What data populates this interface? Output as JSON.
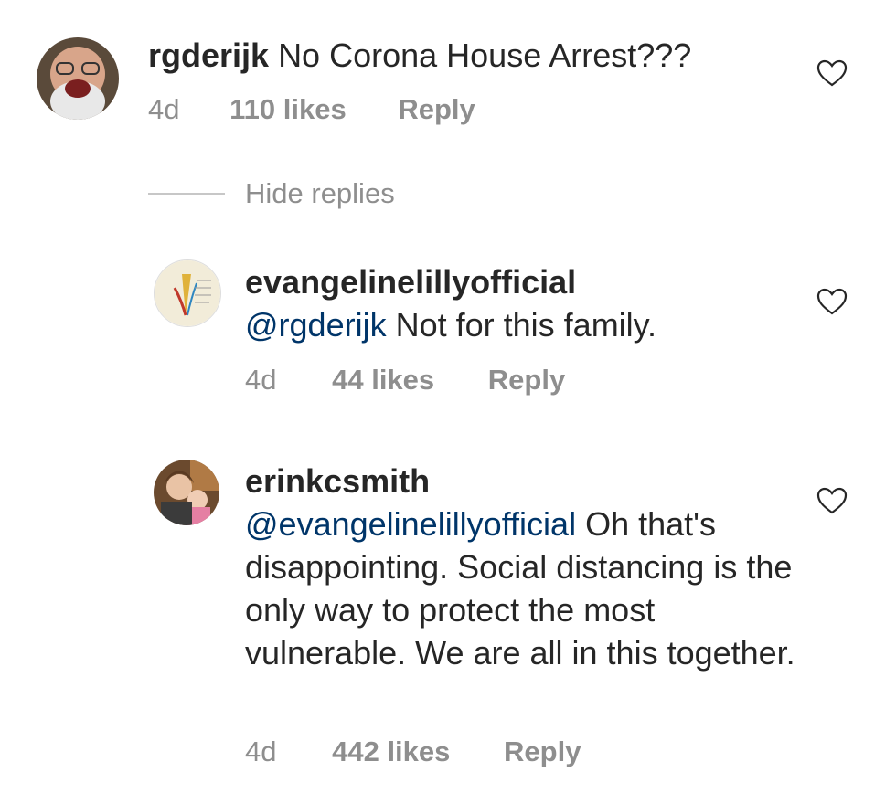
{
  "comments": [
    {
      "username": "rgderijk",
      "mention": "",
      "text": "No Corona House Arrest???",
      "time": "4d",
      "likes": "110 likes",
      "reply": "Reply"
    },
    {
      "username": "evangelinelillyofficial",
      "mention": "@rgderijk",
      "text": "Not for this family.",
      "time": "4d",
      "likes": "44 likes",
      "reply": "Reply"
    },
    {
      "username": "erinkcsmith",
      "mention": "@evangelinelillyofficial",
      "text": "Oh that's disappointing. Social distancing is the only way to protect the most vulnerable. We are all in this together.",
      "time": "4d",
      "likes": "442 likes",
      "reply": "Reply"
    }
  ],
  "hide_replies": "Hide replies",
  "icons": {
    "like": "heart-outline-icon"
  },
  "colors": {
    "text": "#262626",
    "meta": "#8e8e8e",
    "mention": "#003569",
    "background": "#ffffff"
  }
}
